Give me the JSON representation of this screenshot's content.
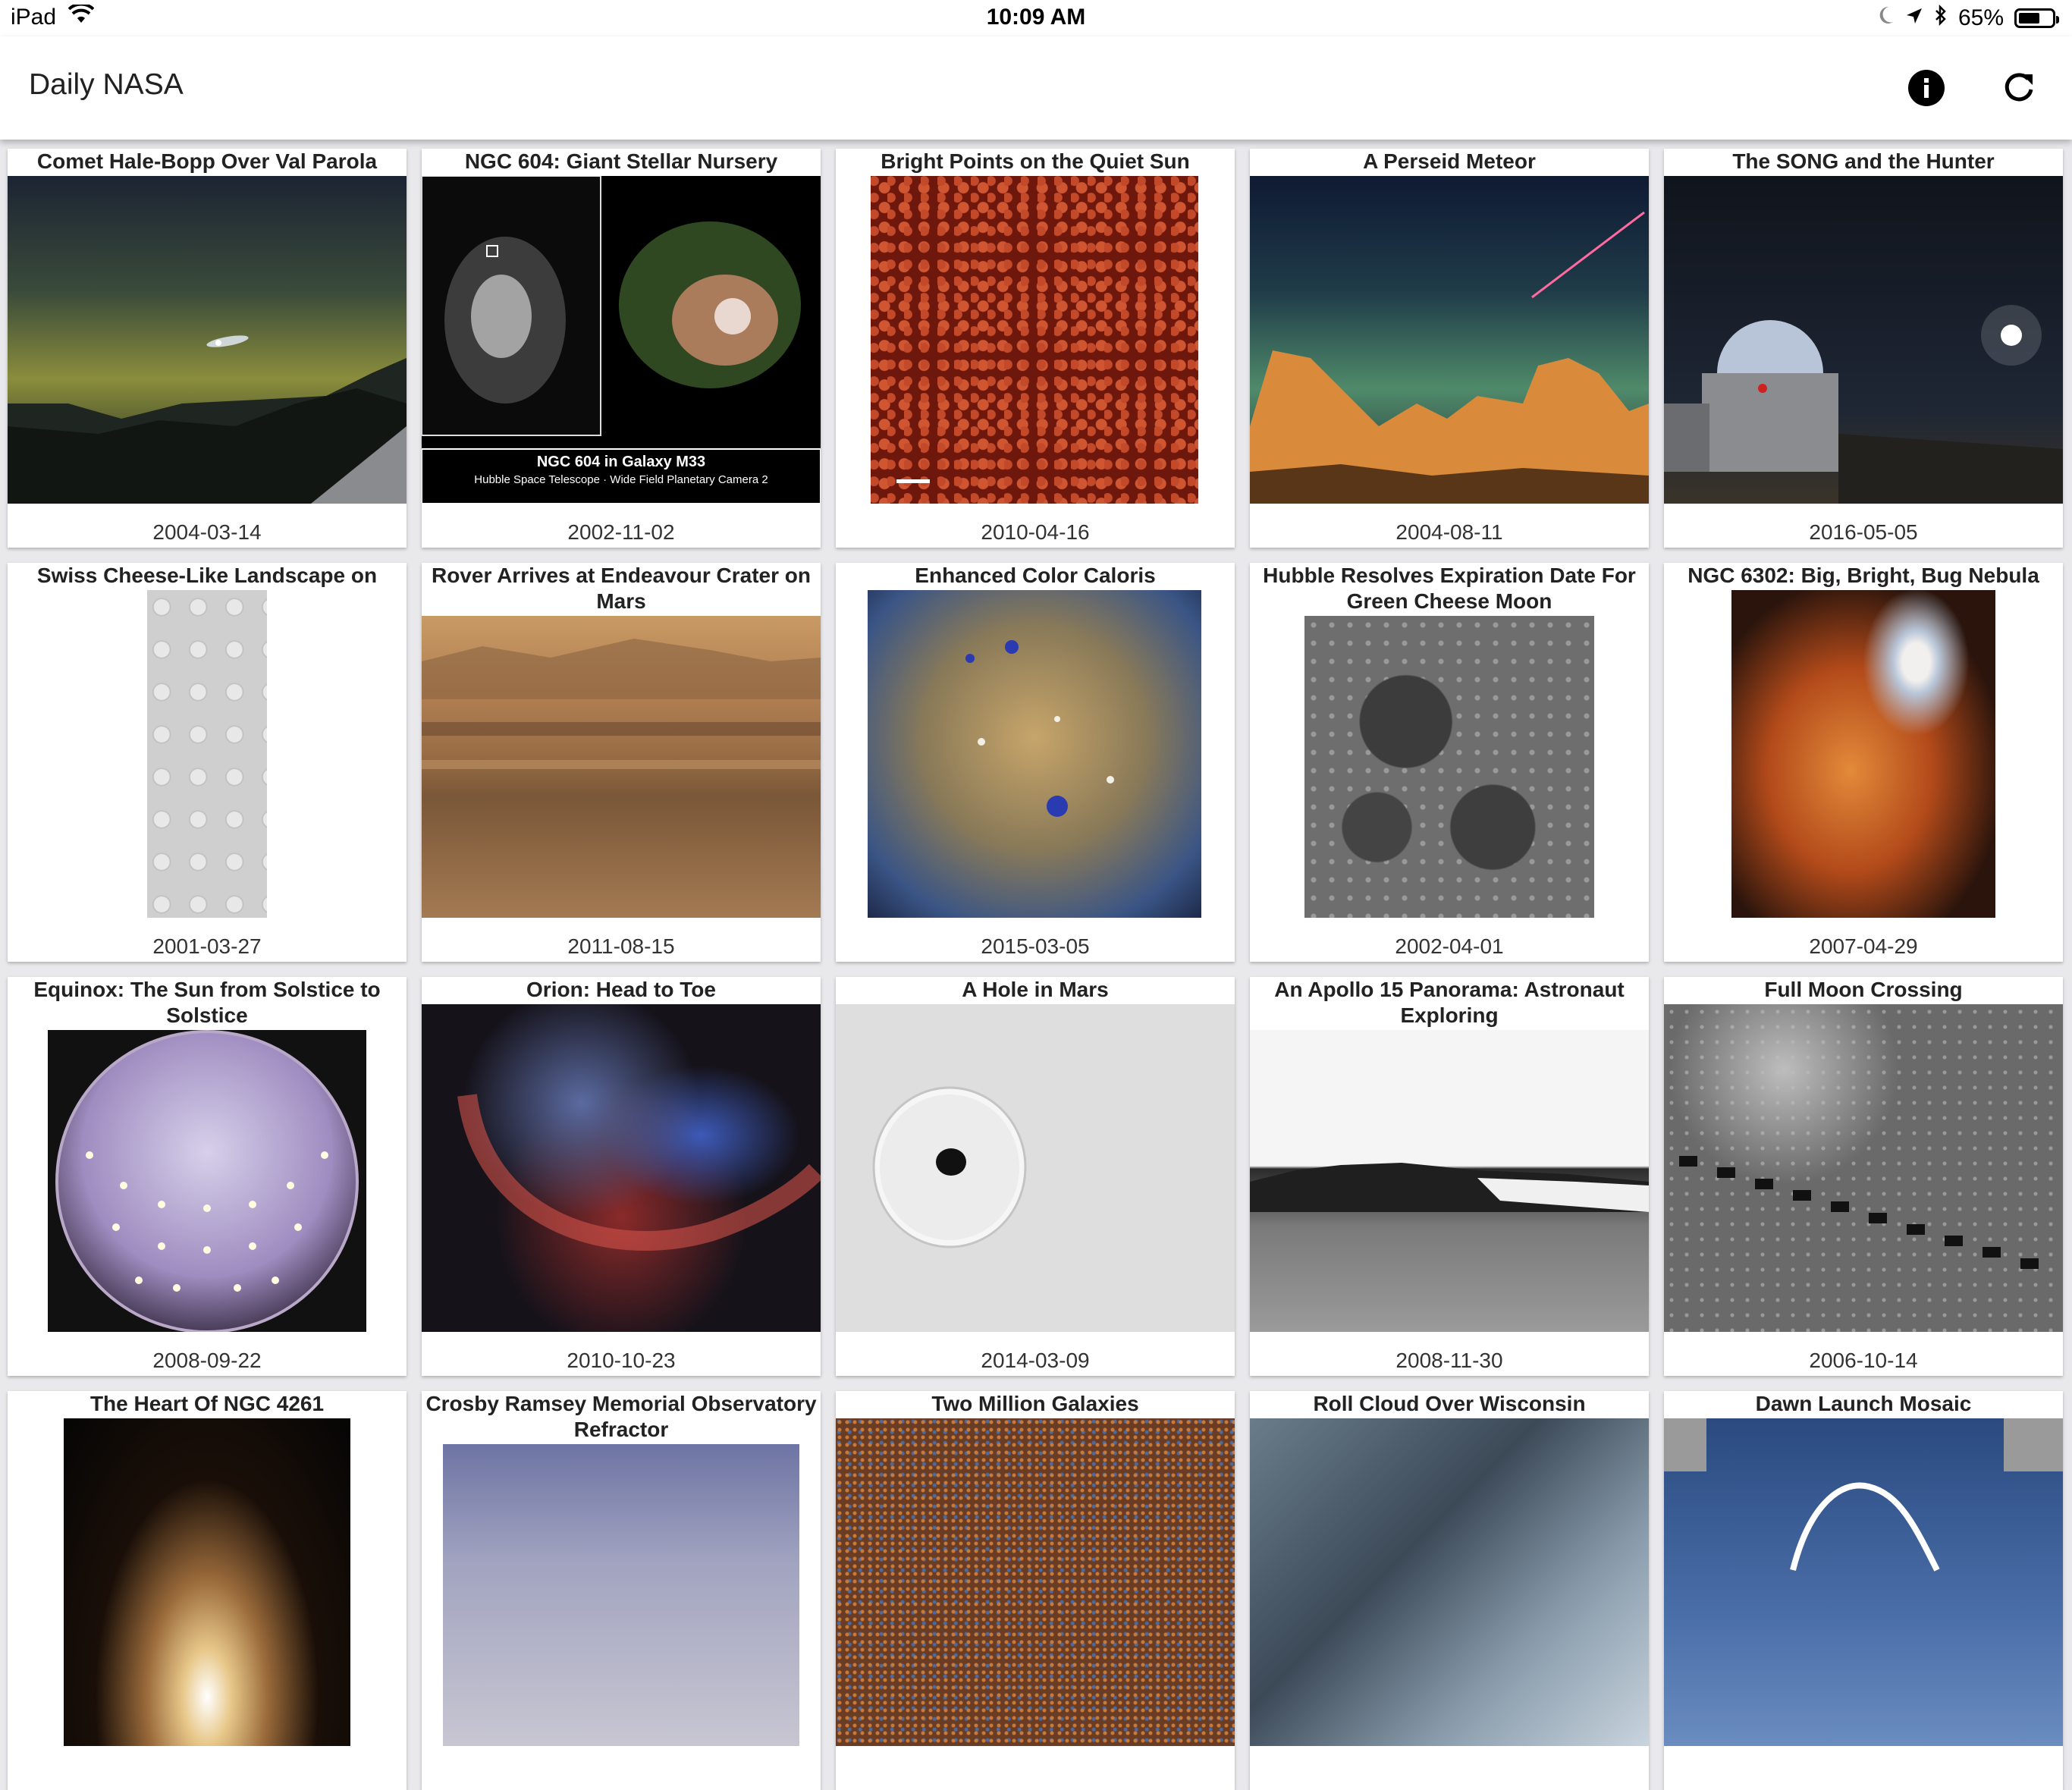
{
  "status_bar": {
    "device": "iPad",
    "time": "10:09 AM",
    "battery": "65%",
    "battery_level": 0.65
  },
  "header": {
    "title": "Daily NASA",
    "info_icon": "info-icon",
    "refresh_icon": "refresh-icon"
  },
  "items": [
    {
      "title": "Comet Hale-Bopp Over Val Parola Pass",
      "date": "2004-03-14"
    },
    {
      "title": "NGC 604: Giant Stellar Nursery",
      "date": "2002-11-02",
      "image_caption": "NGC 604 in Galaxy M33",
      "image_subcaption": "Hubble Space Telescope · Wide Field Planetary Camera 2"
    },
    {
      "title": "Bright Points on the Quiet Sun",
      "date": "2010-04-16"
    },
    {
      "title": "A Perseid Meteor",
      "date": "2004-08-11"
    },
    {
      "title": "The SONG and the Hunter",
      "date": "2016-05-05"
    },
    {
      "title": "Swiss Cheese-Like Landscape on Mars",
      "date": "2001-03-27"
    },
    {
      "title": "Rover Arrives at Endeavour Crater on Mars",
      "date": "2011-08-15"
    },
    {
      "title": "Enhanced Color Caloris",
      "date": "2015-03-05"
    },
    {
      "title": "Hubble Resolves Expiration Date For Green Cheese Moon",
      "date": "2002-04-01"
    },
    {
      "title": "NGC 6302: Big, Bright, Bug Nebula",
      "date": "2007-04-29"
    },
    {
      "title": "Equinox: The Sun from Solstice to Solstice",
      "date": "2008-09-22"
    },
    {
      "title": "Orion: Head to Toe",
      "date": "2010-10-23"
    },
    {
      "title": "A Hole in Mars",
      "date": "2014-03-09"
    },
    {
      "title": "An Apollo 15 Panorama: Astronaut Exploring",
      "date": "2008-11-30"
    },
    {
      "title": "Full Moon Crossing",
      "date": "2006-10-14"
    },
    {
      "title": "The Heart Of NGC 4261",
      "date": ""
    },
    {
      "title": "Crosby Ramsey Memorial Observatory Refractor",
      "date": ""
    },
    {
      "title": "Two Million Galaxies",
      "date": ""
    },
    {
      "title": "Roll Cloud Over Wisconsin",
      "date": ""
    },
    {
      "title": "Dawn Launch Mosaic",
      "date": ""
    }
  ]
}
